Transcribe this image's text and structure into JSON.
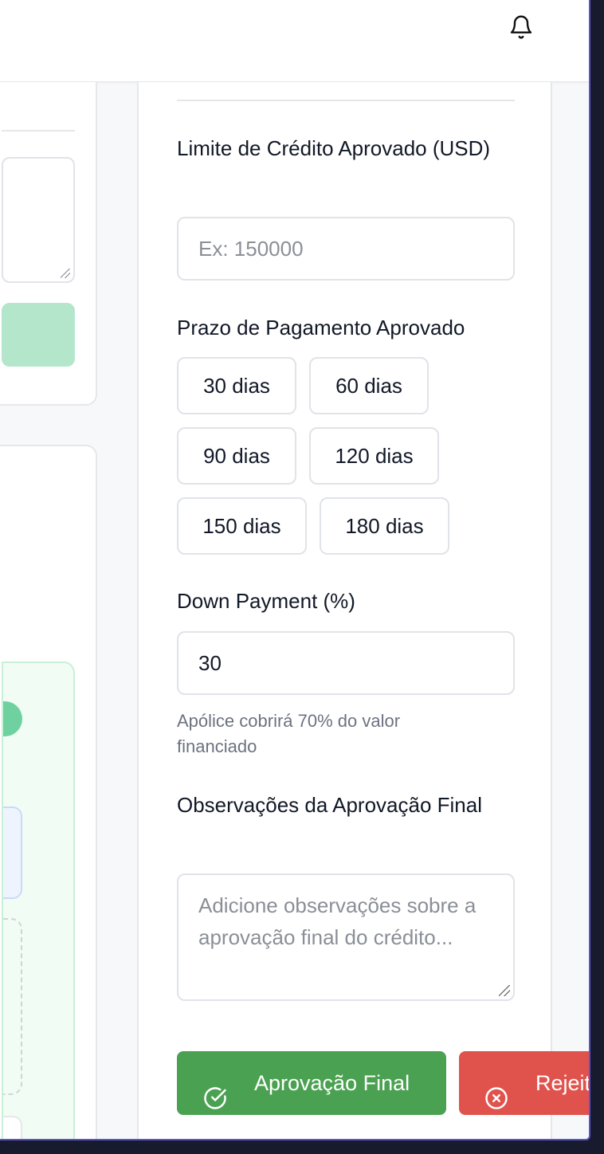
{
  "header": {
    "notification_icon": "bell-icon"
  },
  "form": {
    "credit_limit": {
      "label": "Limite de Crédito Aprovado (USD)",
      "placeholder": "Ex: 150000",
      "value": ""
    },
    "payment_term": {
      "label": "Prazo de Pagamento Aprovado",
      "options": [
        "30 dias",
        "60 dias",
        "90 dias",
        "120 dias",
        "150 dias",
        "180 dias"
      ]
    },
    "down_payment": {
      "label": "Down Payment (%)",
      "value": "30",
      "hint": "Apólice cobrirá 70% do valor financiado"
    },
    "observations": {
      "label": "Observações da Aprovação Final",
      "placeholder": "Adicione observações sobre a aprovação final do crédito...",
      "value": ""
    }
  },
  "actions": {
    "approve_label": "Aprovação Final",
    "approve_icon": "check-circle-icon",
    "reject_label": "Rejeitar",
    "reject_icon": "x-circle-icon"
  },
  "colors": {
    "approve": "#4ba152",
    "reject": "#e0534d",
    "window_border": "#5b55c9"
  }
}
